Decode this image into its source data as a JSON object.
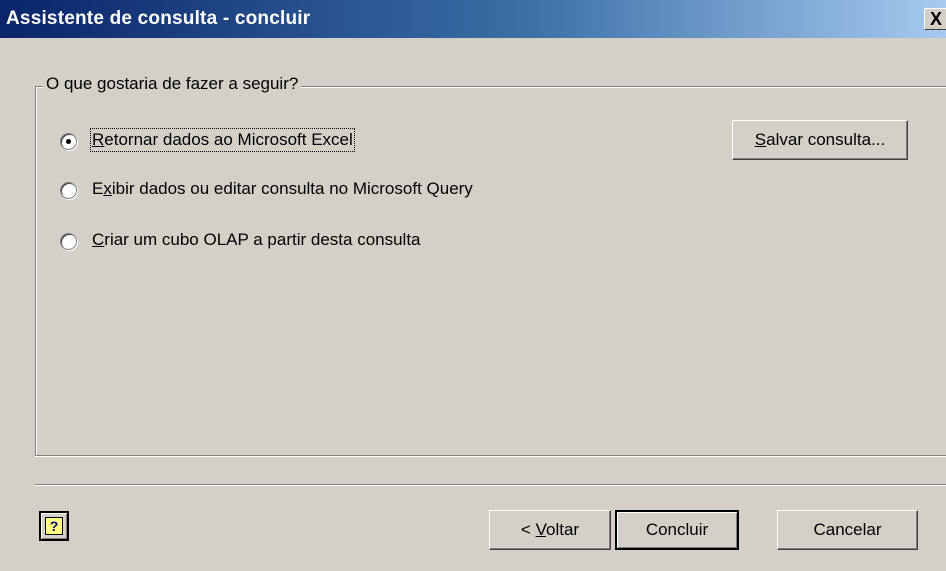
{
  "window": {
    "title": "Assistente de consulta - concluir",
    "close_symbol": "X"
  },
  "group": {
    "legend": "O que gostaria de fazer a seguir?"
  },
  "options": [
    {
      "mnemonic": "R",
      "rest": "etornar dados ao Microsoft Excel",
      "checked": true
    },
    {
      "pre": "E",
      "mnemonic": "x",
      "rest": "ibir dados ou editar consulta no Microsoft Query",
      "checked": false
    },
    {
      "mnemonic": "C",
      "rest": "riar um cubo OLAP a partir desta consulta",
      "checked": false
    }
  ],
  "buttons": {
    "save_mnemonic": "S",
    "save_rest": "alvar consulta...",
    "back_pre": "< ",
    "back_mnemonic": "V",
    "back_rest": "oltar",
    "finish": "Concluir",
    "cancel": "Cancelar"
  },
  "icons": {
    "help": "help-icon",
    "help_glyph": "?",
    "close": "close-icon"
  }
}
